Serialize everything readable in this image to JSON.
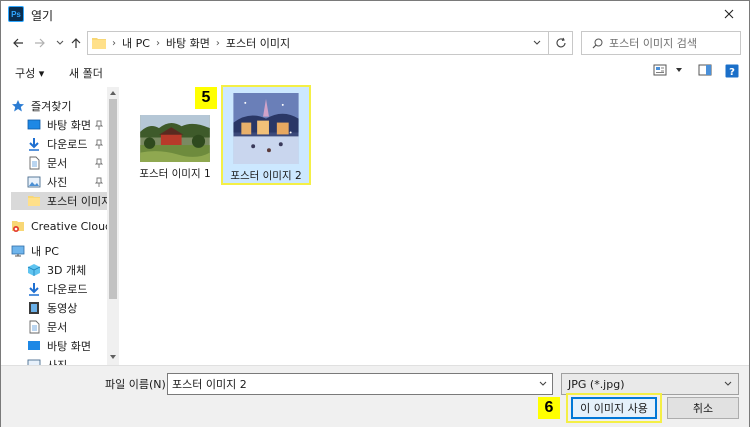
{
  "window": {
    "app_icon_text": "Ps",
    "title": "열기"
  },
  "address": {
    "breadcrumbs": [
      "내 PC",
      "바탕 화면",
      "포스터 이미지"
    ]
  },
  "search": {
    "placeholder": "포스터 이미지 검색"
  },
  "toolbar": {
    "organize_label": "구성 ▾",
    "new_folder_label": "새 폴더"
  },
  "sidebar": {
    "items": [
      {
        "label": "즐겨찾기",
        "icon": "star-icon"
      },
      {
        "label": "바탕 화면",
        "icon": "desktop-icon"
      },
      {
        "label": "다운로드",
        "icon": "download-icon"
      },
      {
        "label": "문서",
        "icon": "document-icon"
      },
      {
        "label": "사진",
        "icon": "pictures-icon"
      },
      {
        "label": "포스터 이미지",
        "icon": "folder-icon"
      },
      {
        "label": "Creative Cloud F",
        "icon": "creative-cloud-icon"
      },
      {
        "label": "내 PC",
        "icon": "pc-icon"
      },
      {
        "label": "3D 개체",
        "icon": "cube-icon"
      },
      {
        "label": "다운로드",
        "icon": "download-icon"
      },
      {
        "label": "동영상",
        "icon": "video-icon"
      },
      {
        "label": "문서",
        "icon": "document-icon"
      },
      {
        "label": "바탕 화면",
        "icon": "desktop-icon"
      },
      {
        "label": "사진",
        "icon": "pictures-icon"
      }
    ]
  },
  "files": [
    {
      "name": "포스터 이미지 1",
      "selected": false
    },
    {
      "name": "포스터 이미지 2",
      "selected": true
    }
  ],
  "annotations": {
    "badge_5": "5",
    "badge_6": "6"
  },
  "bottom": {
    "filename_label": "파일 이름(N):",
    "filename_value": "포스터 이미지 2",
    "filetype_value": "JPG (*.jpg)",
    "open_button": "이 이미지 사용",
    "cancel_button": "취소"
  },
  "colors": {
    "selection_bg": "#cce8ff",
    "highlight_yellow": "#ffff00",
    "primary_border": "#0078d7"
  }
}
